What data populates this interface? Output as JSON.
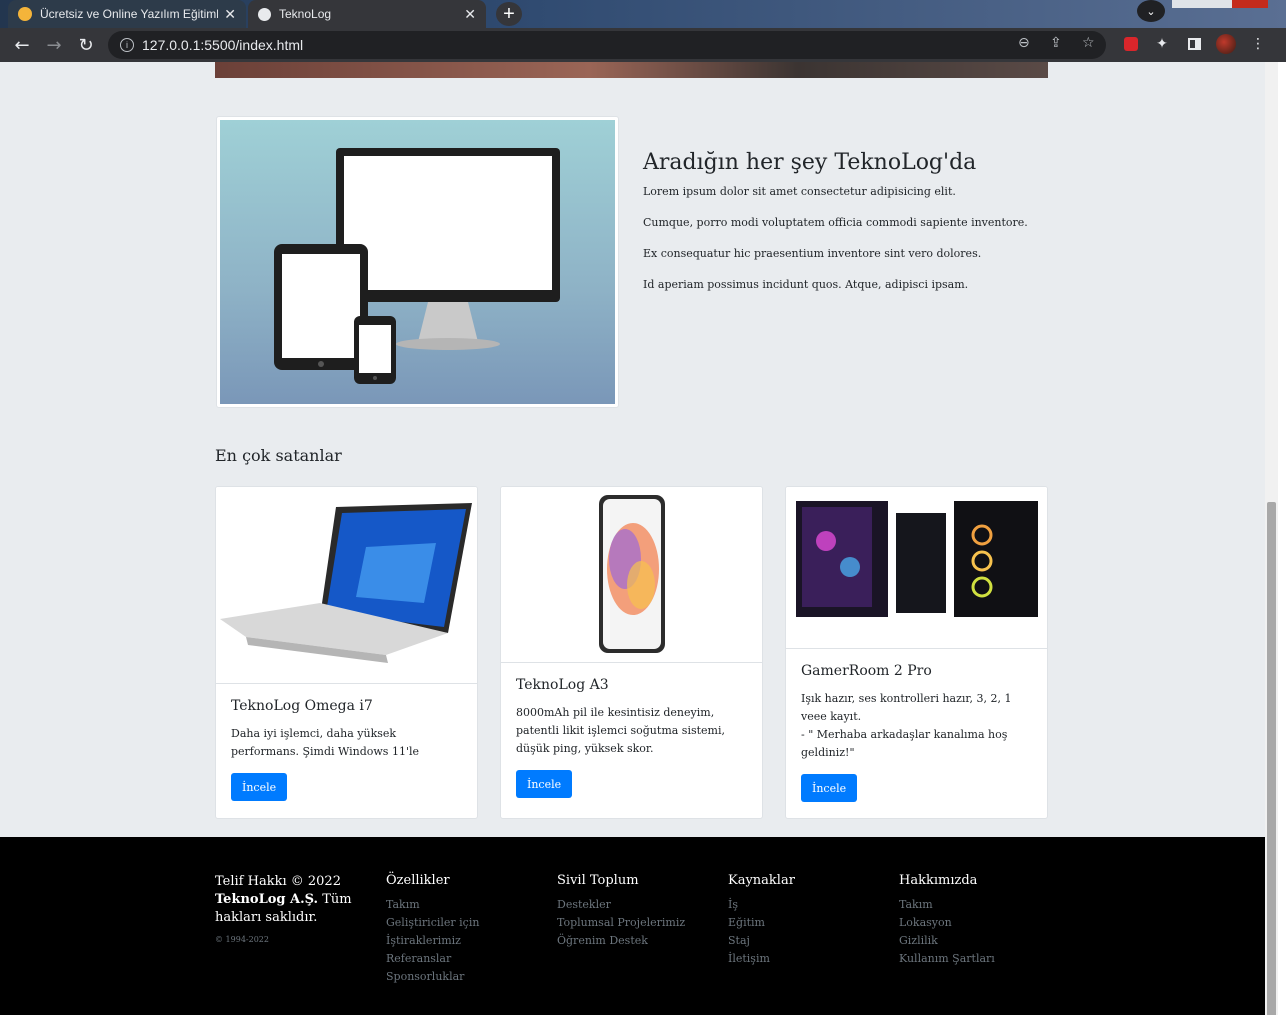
{
  "browser": {
    "tabs": [
      {
        "title": "Ücretsiz ve Online Yazılım Eğitiml",
        "active": false,
        "favicon_color": "#f4b43a"
      },
      {
        "title": "TeknoLog",
        "active": true,
        "favicon_color": "#e8eaed"
      }
    ],
    "new_tab": "+",
    "url": "127.0.0.1:5500/index.html"
  },
  "feature": {
    "title": "Aradığın her şey TeknoLog'da",
    "lines": [
      "Lorem ipsum dolor sit amet consectetur adipisicing elit.",
      "Cumque, porro modi voluptatem officia commodi sapiente inventore.",
      "Ex consequatur hic praesentium inventore sint vero dolores.",
      "Id aperiam possimus incidunt quos. Atque, adipisci ipsam."
    ]
  },
  "bestsellers": {
    "title": "En çok satanlar",
    "cards": [
      {
        "name": "TeknoLog Omega i7",
        "desc": "Daha iyi işlemci, daha yüksek performans. Şimdi Windows 11'le",
        "button": "İncele"
      },
      {
        "name": "TeknoLog A3",
        "desc": "8000mAh pil ile kesintisiz deneyim, patentli likit işlemci soğutma sistemi, düşük ping, yüksek skor.",
        "button": "İncele"
      },
      {
        "name": "GamerRoom 2 Pro",
        "desc_line1": "Işık hazır, ses kontrolleri hazır, 3, 2, 1 veee kayıt.",
        "desc_line2": "- \" Merhaba arkadaşlar kanalıma hoş geldiniz!\"",
        "button": "İncele"
      }
    ]
  },
  "footer": {
    "copyright": {
      "line1": "Telif Hakkı © 2022",
      "company": "TeknoLog A.Ş.",
      "line2": " Tüm hakları saklıdır.",
      "years": "© 1994-2022"
    },
    "columns": [
      {
        "title": "Özellikler",
        "items": [
          "Takım",
          "Geliştiriciler için",
          "İştiraklerimiz",
          "Referanslar",
          "Sponsorluklar"
        ]
      },
      {
        "title": "Sivil Toplum",
        "items": [
          "Destekler",
          "Toplumsal Projelerimiz",
          "Öğrenim Destek"
        ]
      },
      {
        "title": "Kaynaklar",
        "items": [
          "İş",
          "Eğitim",
          "Staj",
          "İletişim"
        ]
      },
      {
        "title": "Hakkımızda",
        "items": [
          "Takım",
          "Lokasyon",
          "Gizlilik",
          "Kullanım Şartları"
        ]
      }
    ]
  }
}
